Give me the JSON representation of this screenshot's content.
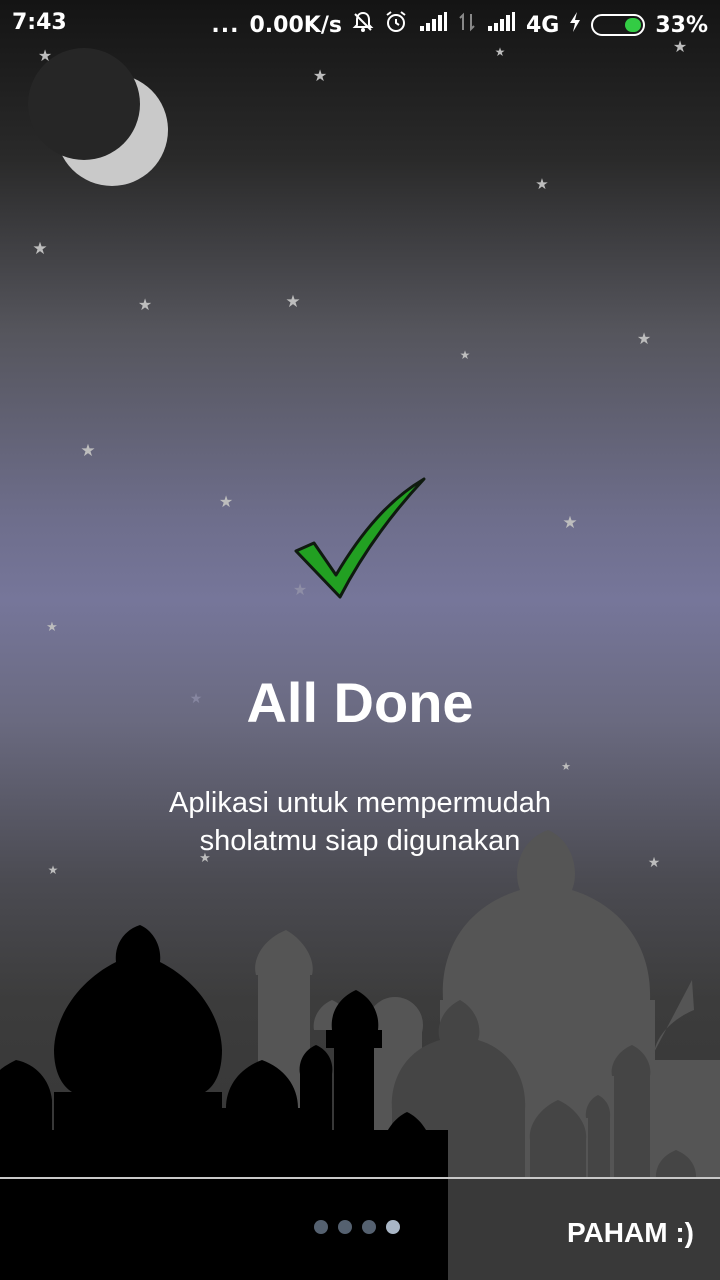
{
  "status_bar": {
    "time": "7:43",
    "overflow": "...",
    "net_speed": "0.00K/s",
    "network": "4G",
    "battery": "33%",
    "battery_level": 0.33,
    "icons": [
      "notifications-muted-icon",
      "alarm-icon",
      "signal-icon",
      "data-transfer-icon",
      "signal-icon",
      "charging-icon",
      "battery-icon"
    ]
  },
  "main": {
    "title": "All Done",
    "subtitle_line1": "Aplikasi untuk mempermudah",
    "subtitle_line2": "sholatmu siap digunakan",
    "check_color": "#22a022"
  },
  "footer": {
    "page_count": 4,
    "active_page": 4,
    "button_label": "PAHAM :)"
  },
  "colors": {
    "sky_top": "#141414",
    "sky_mid": "#76769a",
    "dot_inactive": "#556170",
    "dot_active": "#a9b6c6"
  }
}
